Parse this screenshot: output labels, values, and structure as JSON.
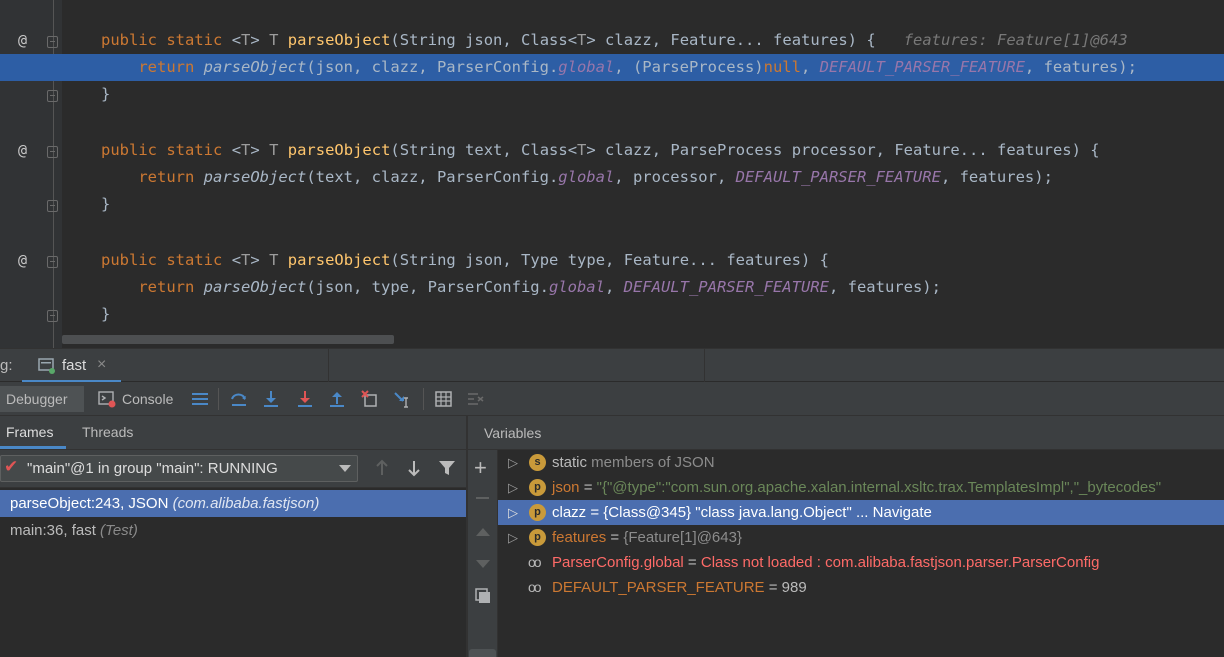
{
  "editor": {
    "method1": {
      "sig_before": "(String json, Class<",
      "sig_mid": "> clazz, Feature... features) {",
      "hint": "features: Feature[1]@643",
      "ret_args1": "(json, clazz, ParserConfig.",
      "ret_args2": ", (ParseProcess)",
      "ret_args3": ", features);"
    },
    "method2": {
      "sig_before": "(String text, Class<",
      "sig_mid": "> clazz, ParseProcess processor, Feature... features) {",
      "ret_args1": "(text, clazz, ParserConfig.",
      "ret_args2": ", processor, ",
      "ret_args3": ", features);"
    },
    "method3": {
      "sig_before": "(String json, Type type, Feature... features) {",
      "ret_args1": "(json, type, ParserConfig.",
      "ret_args2": ", ",
      "ret_args3": ", features);"
    },
    "kw_public": "public",
    "kw_static": "static",
    "kw_return": "return",
    "kw_null": "null",
    "generic_open": "<",
    "generic_T": "T",
    "generic_close": ">",
    "type_T": "T",
    "method_name": "parseObject",
    "field_global": "global",
    "const_feature": "DEFAULT_PARSER_FEATURE",
    "brace_close": "}",
    "gutter_at": "@"
  },
  "debug_tabbar": {
    "label": "g:",
    "tab_name": "fast",
    "close": "×"
  },
  "toolbar": {
    "debugger_label": "Debugger",
    "console_label": "Console"
  },
  "frames_panel": {
    "tab_frames": "Frames",
    "tab_threads": "Threads",
    "thread_combo": "\"main\"@1 in group \"main\": RUNNING",
    "frames": [
      {
        "label": "parseObject:243, JSON ",
        "detail": "(com.alibaba.fastjson)",
        "selected": true
      },
      {
        "label": "main:36, fast ",
        "detail": "(Test)",
        "selected": false
      }
    ]
  },
  "variables_panel": {
    "title": "Variables",
    "rows": [
      {
        "kind": "static",
        "badge": "s",
        "name": "static",
        "rest": " members of JSON"
      },
      {
        "kind": "param",
        "badge": "p",
        "name": "json",
        "eq": " = ",
        "value": "\"{\"@type\":\"com.sun.org.apache.xalan.internal.xsltc.trax.TemplatesImpl\",\"_bytecodes\""
      },
      {
        "kind": "param",
        "badge": "p",
        "name": "clazz",
        "eq": " = ",
        "value": "{Class@345} \"class java.lang.Object\" ... Navigate",
        "selected": true
      },
      {
        "kind": "param",
        "badge": "p",
        "name": "features",
        "eq": " = ",
        "value": "{Feature[1]@643}"
      },
      {
        "kind": "watch",
        "name": "ParserConfig.global",
        "eq": " = ",
        "value": "Class not loaded : com.alibaba.fastjson.parser.ParserConfig"
      },
      {
        "kind": "watch",
        "name": "DEFAULT_PARSER_FEATURE",
        "eq": " = ",
        "value": "989"
      }
    ]
  },
  "colors": {
    "keyword": "#cc7832",
    "method": "#ffc66d",
    "static_field": "#9876aa",
    "selection": "#4b6eaf",
    "editor_highlight": "#2d5ea5",
    "error_text": "#ff6b68"
  }
}
